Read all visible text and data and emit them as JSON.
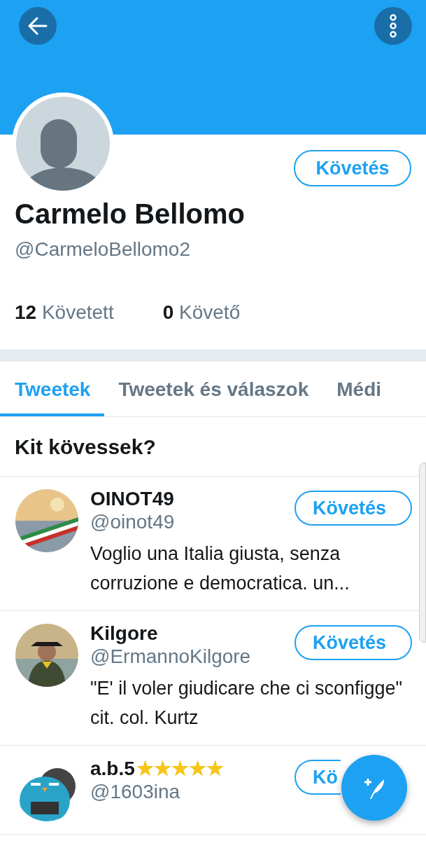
{
  "profile": {
    "name": "Carmelo Bellomo",
    "handle": "@CarmeloBellomo2",
    "follow_button": "Követés",
    "stats": [
      {
        "count": "12",
        "label": "Követett"
      },
      {
        "count": "0",
        "label": "Követő"
      }
    ]
  },
  "tabs": [
    {
      "label": "Tweetek",
      "selected": true
    },
    {
      "label": "Tweetek és válaszok",
      "selected": false
    },
    {
      "label": "Médi",
      "selected": false
    }
  ],
  "suggestions": {
    "title": "Kit kövessek?",
    "users": [
      {
        "name": "OINOT49",
        "handle": "@oinot49",
        "bio": "Voglio una Italia giusta, senza corruzione e democratica. un...",
        "button": "Követés"
      },
      {
        "name": "Kilgore",
        "handle": "@ErmannoKilgore",
        "bio": "\"E' il voler giudicare che ci sconfigge\" cit. col. Kurtz",
        "button": "Követés"
      },
      {
        "name": "a.b.5",
        "badge": "★★★★★",
        "handle": "@1603ina",
        "button": "Kö"
      }
    ]
  }
}
